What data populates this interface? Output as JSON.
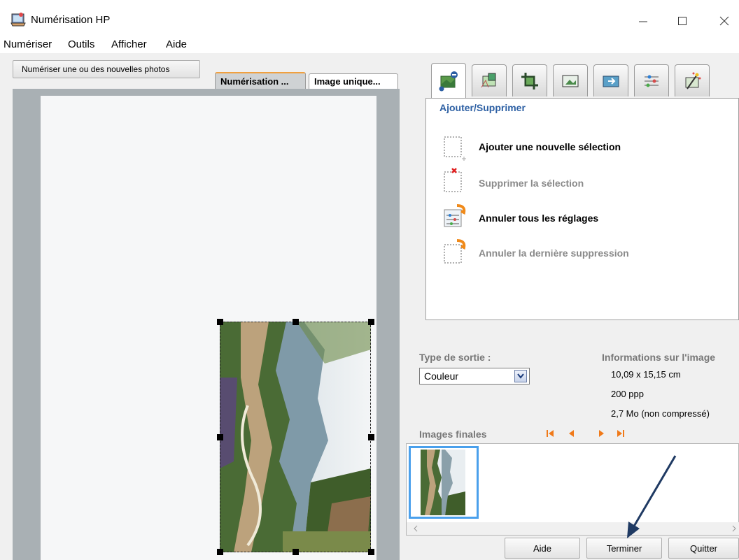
{
  "window": {
    "title": "Numérisation HP"
  },
  "menu": [
    "Numériser",
    "Outils",
    "Afficher",
    "Aide"
  ],
  "left": {
    "scan_button": "Numériser une ou des nouvelles photos",
    "tabs": [
      "Numérisation ...",
      "Image unique..."
    ]
  },
  "panel": {
    "title": "Ajouter/Supprimer",
    "actions": [
      {
        "label": "Ajouter une nouvelle sélection",
        "enabled": true
      },
      {
        "label": "Supprimer la sélection",
        "enabled": false
      },
      {
        "label": "Annuler tous les réglages",
        "enabled": true
      },
      {
        "label": "Annuler la dernière suppression",
        "enabled": false
      }
    ]
  },
  "output": {
    "label": "Type de sortie :",
    "value": "Couleur"
  },
  "info": {
    "title": "Informations sur l'image",
    "size": "10,09 x 15,15 cm",
    "resolution": "200 ppp",
    "filesize": "2,7 Mo (non compressé)"
  },
  "final_images": {
    "label": "Images finales"
  },
  "buttons": {
    "help": "Aide",
    "finish": "Terminer",
    "quit": "Quitter"
  },
  "colors": {
    "accent_blue": "#2c5fa3",
    "nav_orange": "#f07a1a",
    "arrow": "#1f3a63"
  }
}
